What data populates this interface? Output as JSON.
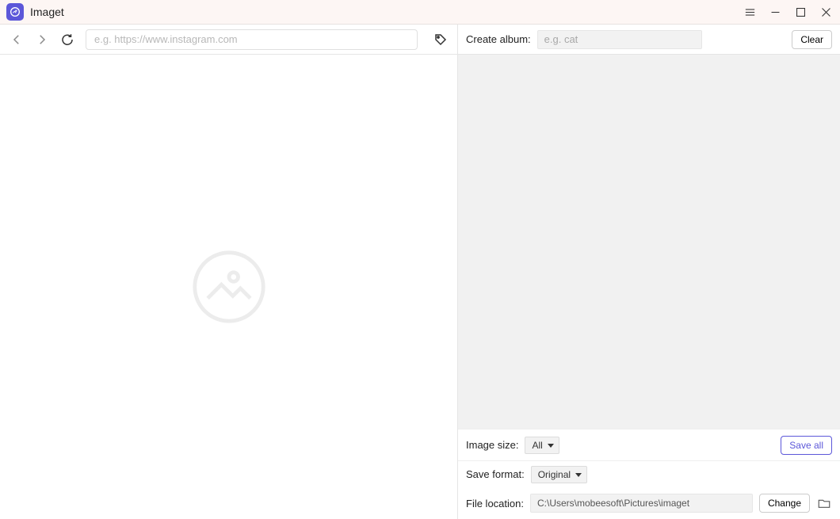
{
  "app": {
    "title": "Imaget"
  },
  "nav": {
    "url_placeholder": "e.g. https://www.instagram.com"
  },
  "album": {
    "label": "Create album:",
    "placeholder": "e.g. cat",
    "clear_label": "Clear"
  },
  "sizeRow": {
    "label": "Image size:",
    "select_value": "All",
    "save_all_label": "Save all"
  },
  "formatRow": {
    "label": "Save format:",
    "select_value": "Original"
  },
  "locationRow": {
    "label": "File location:",
    "path": "C:\\Users\\mobeesoft\\Pictures\\imaget",
    "change_label": "Change"
  }
}
